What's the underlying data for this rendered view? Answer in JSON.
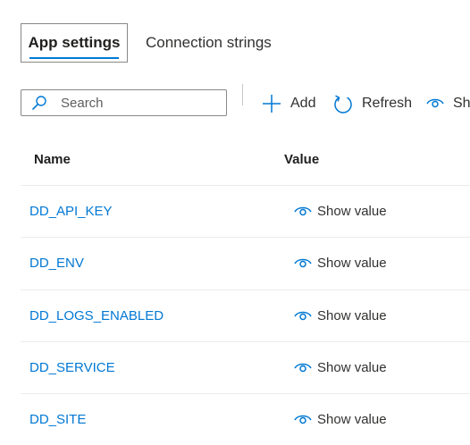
{
  "tabs": [
    {
      "label": "App settings",
      "active": true
    },
    {
      "label": "Connection strings",
      "active": false
    }
  ],
  "search": {
    "placeholder": "Search",
    "value": ""
  },
  "toolbar": {
    "add_label": "Add",
    "refresh_label": "Refresh",
    "show_label": "Show values"
  },
  "table": {
    "columns": [
      "Name",
      "Value"
    ],
    "rows": [
      {
        "name": "DD_API_KEY",
        "value_label": "Show value"
      },
      {
        "name": "DD_ENV",
        "value_label": "Show value"
      },
      {
        "name": "DD_LOGS_ENABLED",
        "value_label": "Show value"
      },
      {
        "name": "DD_SERVICE",
        "value_label": "Show value"
      },
      {
        "name": "DD_SITE",
        "value_label": "Show value"
      }
    ]
  },
  "colors": {
    "accent": "#0078d4",
    "text": "#323130",
    "border": "#8a8886",
    "row_divider": "#edebe9"
  },
  "icons": [
    "search-icon",
    "add-icon",
    "refresh-icon",
    "eye-icon"
  ]
}
